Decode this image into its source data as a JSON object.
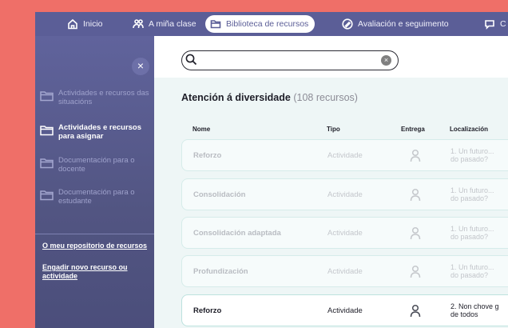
{
  "nav": {
    "items": [
      {
        "label": "Inicio",
        "icon": "home-icon"
      },
      {
        "label": "A miña clase",
        "icon": "people-icon"
      },
      {
        "label": "Biblioteca de recursos",
        "icon": "folder-icon",
        "active": true
      },
      {
        "label": "Avaliación e seguimento",
        "icon": "pencil-icon"
      },
      {
        "label": "C",
        "icon": "chat-icon"
      }
    ]
  },
  "sidebar": {
    "close_label": "×",
    "items": [
      {
        "label": "Actividades e recursos das situacións",
        "active": false
      },
      {
        "label": "Actividades e recursos para asignar",
        "active": true
      },
      {
        "label": "Documentación para o docente",
        "active": false
      },
      {
        "label": "Documentación para o estudante",
        "active": false
      }
    ],
    "links": [
      "O meu repositorio de recursos",
      "Engadir novo recurso ou actividade"
    ]
  },
  "search": {
    "value": "",
    "placeholder": "",
    "clear_label": "×"
  },
  "section": {
    "title": "Atención á diversidade",
    "count": "(108 recursos)"
  },
  "table": {
    "headers": [
      "Nome",
      "Tipo",
      "Entrega",
      "Localización"
    ],
    "rows": [
      {
        "name": "Reforzo",
        "type": "Actividade",
        "loc_1": "1. Un futuro...",
        "loc_2": "do pasado?",
        "faded": true
      },
      {
        "name": "Consolidación",
        "type": "Actividade",
        "loc_1": "1. Un futuro...",
        "loc_2": "do pasado?",
        "faded": true
      },
      {
        "name": "Consolidación adaptada",
        "type": "Actividade",
        "loc_1": "1. Un futuro...",
        "loc_2": "do pasado?",
        "faded": true
      },
      {
        "name": "Profundización",
        "type": "Actividade",
        "loc_1": "1. Un futuro...",
        "loc_2": "do pasado?",
        "faded": true
      },
      {
        "name": "Reforzo",
        "type": "Actividade",
        "loc_1": "2. Non chove g",
        "loc_2": "de todos",
        "faded": false
      }
    ]
  },
  "colors": {
    "background": "#ef6f68",
    "nav": "#5b5e97",
    "sidebar": "#525582",
    "content": "#eef6f6"
  }
}
